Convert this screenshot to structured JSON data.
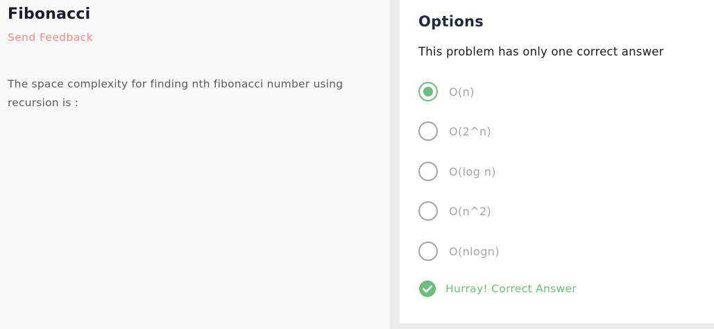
{
  "problem": {
    "title": "Fibonacci",
    "feedback_label": "Send Feedback",
    "question": "The space complexity for finding nth fibonacci number using recursion is :"
  },
  "options_panel": {
    "heading": "Options",
    "subtitle": "This problem has only one correct answer",
    "options": [
      {
        "label": "O(n)",
        "selected": true
      },
      {
        "label": "O(2^n)",
        "selected": false
      },
      {
        "label": "O(log n)",
        "selected": false
      },
      {
        "label": "O(n^2)",
        "selected": false
      },
      {
        "label": "O(nlogn)",
        "selected": false
      }
    ],
    "result_text": "Hurray! Correct Answer",
    "result_icon": "check-circle-icon"
  },
  "colors": {
    "accent_green": "#6bbf7e",
    "feedback_red": "#f28a8a",
    "radio_gray": "#a3a3a3",
    "title_dark": "#1c1c2e"
  }
}
